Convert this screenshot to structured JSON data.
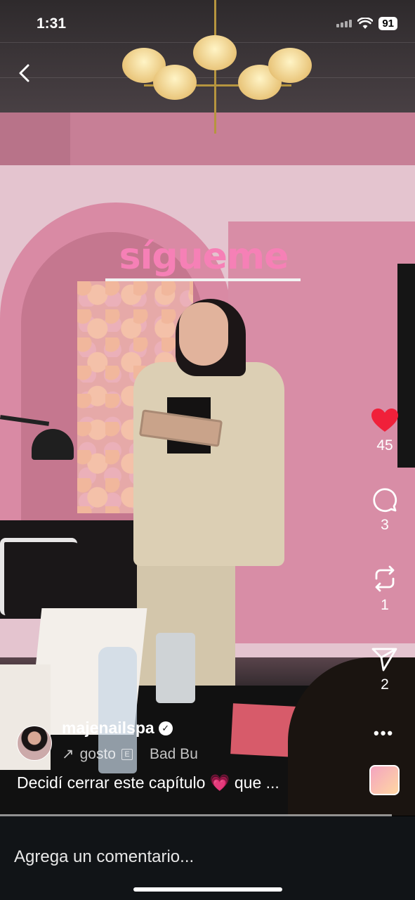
{
  "status_bar": {
    "time": "1:31",
    "battery": "91"
  },
  "overlay": {
    "text": "sígueme"
  },
  "actions": {
    "likes": "45",
    "comments": "3",
    "reposts": "1",
    "shares": "2"
  },
  "author": {
    "username": "majenailspa",
    "verified_mark": "✓"
  },
  "audio": {
    "track_text": "gosto",
    "explicit": "E",
    "artist_text": "Bad Bu"
  },
  "caption": {
    "text": "Decidí cerrar este capítulo 💗 que ..."
  },
  "comment_bar": {
    "placeholder": "Agrega un comentario..."
  },
  "colors": {
    "like": "#f0203a",
    "overlay_text": "#f680b6",
    "comment_bar": "#111417"
  },
  "icons": [
    "back-chevron-icon",
    "wifi-icon",
    "signal-icon",
    "battery-icon",
    "heart-icon",
    "comment-icon",
    "repost-icon",
    "send-icon",
    "more-icon",
    "verified-icon",
    "audio-arrow-icon",
    "explicit-icon"
  ]
}
